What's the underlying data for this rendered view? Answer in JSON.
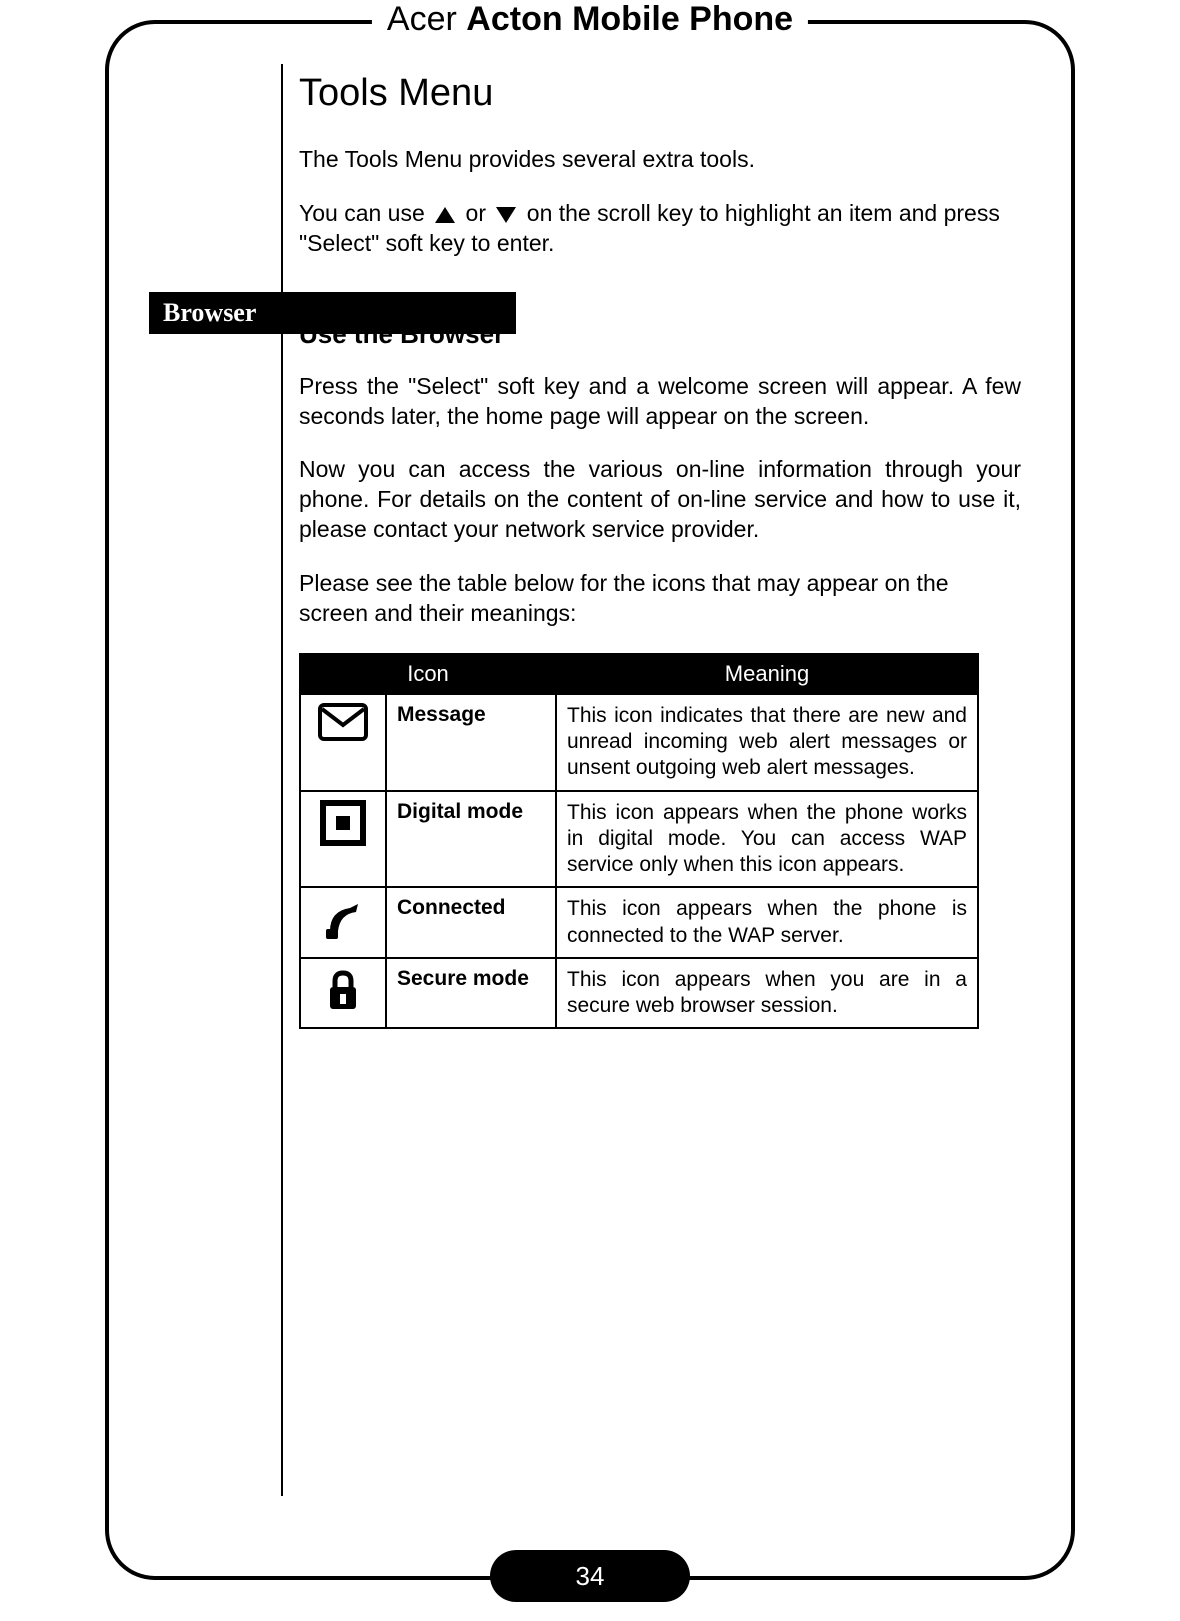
{
  "doc_title": {
    "brand": "Acer",
    "model": "Acton",
    "product": "Mobile Phone"
  },
  "section_title": "Tools Menu",
  "intro_para": "The Tools Menu provides several extra tools.",
  "scroll_para_pre": "You can use ",
  "scroll_para_mid": " or ",
  "scroll_para_post": " on the scroll key to highlight an item and press \"Select\" soft key to enter.",
  "tab_label": "Browser",
  "subheading": "Use the Browser",
  "browser_para1": "Press the \"Select\" soft key and a welcome screen will appear. A few seconds later, the home page will appear on the screen.",
  "browser_para2": "Now you can access the various on-line information through your phone. For details on the content of on-line service and how to use it, please contact your network service provider.",
  "browser_para3": "Please see the table below for the icons that may appear on the screen and their meanings:",
  "table": {
    "headers": {
      "icon": "Icon",
      "meaning": "Meaning"
    },
    "rows": [
      {
        "name": "Message",
        "meaning": "This icon indicates that there are new and unread incoming web alert messages or unsent outgoing web alert messages."
      },
      {
        "name": "Digital mode",
        "meaning": "This icon appears when the phone works in digital mode. You can access WAP service only when this icon appears."
      },
      {
        "name": "Connected",
        "meaning": "This icon appears when the phone is connected to the WAP server."
      },
      {
        "name": "Secure mode",
        "meaning": "This icon appears when you are in a secure web browser session."
      }
    ]
  },
  "page_number": "34"
}
